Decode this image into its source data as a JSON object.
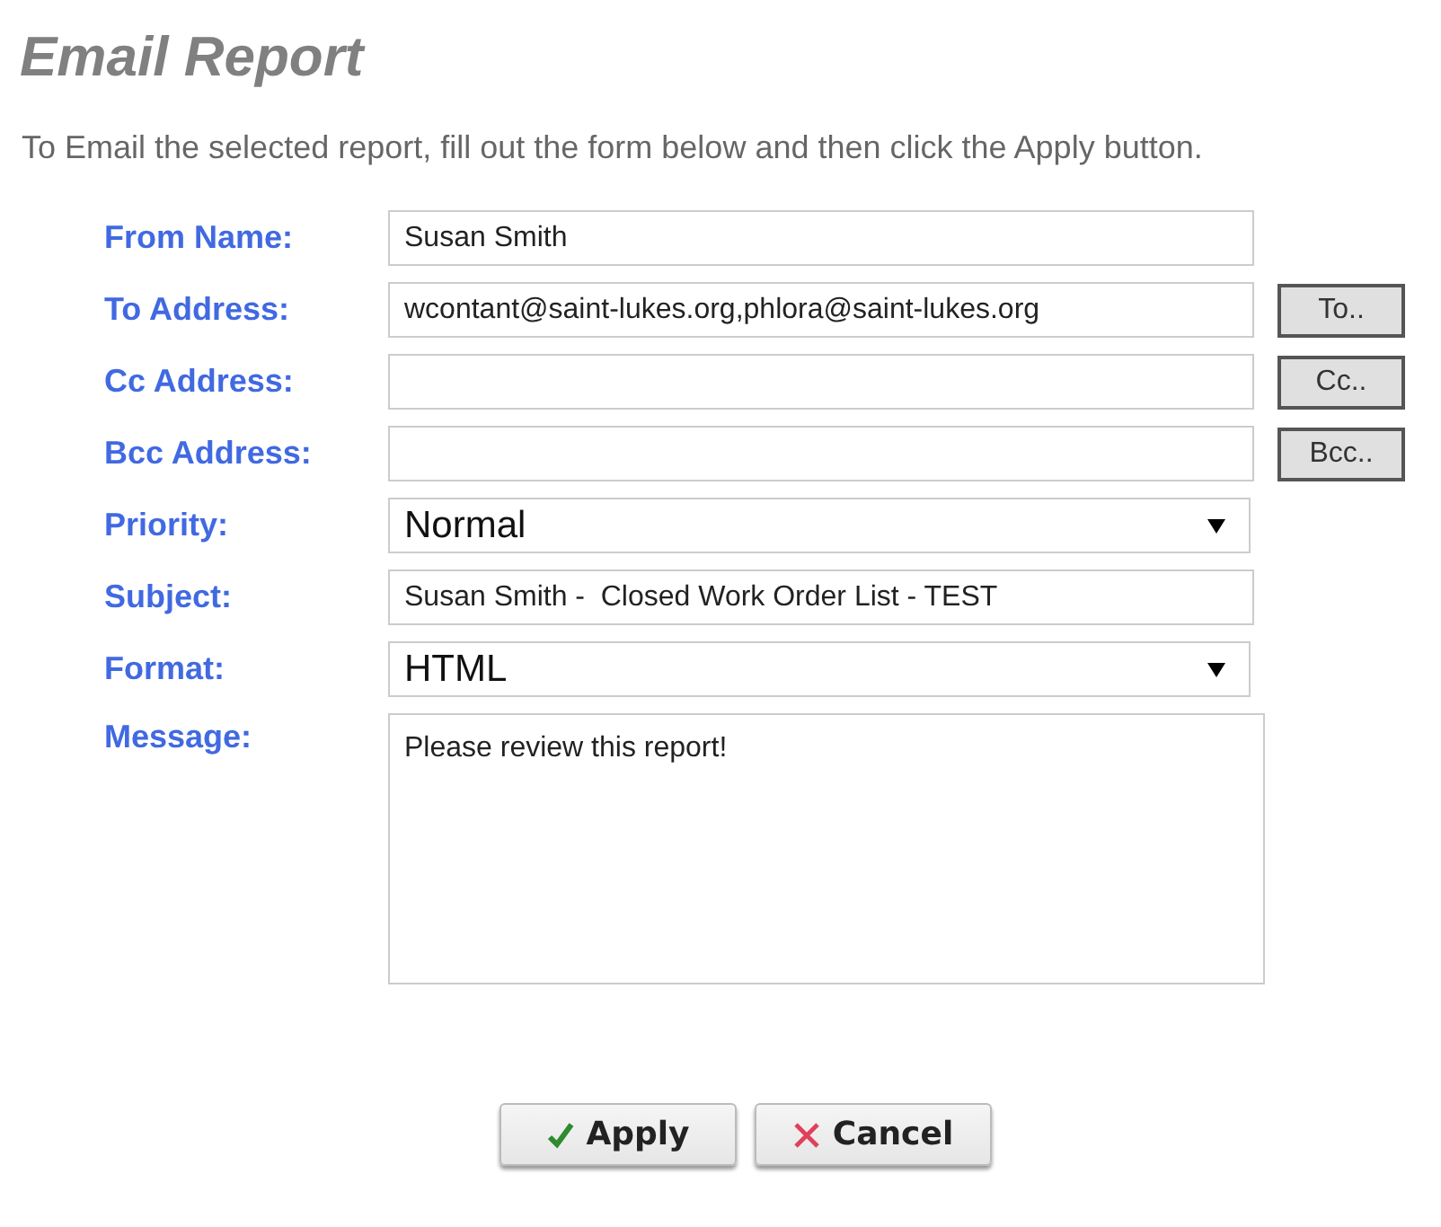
{
  "title": "Email Report",
  "instructions": "To Email the selected report, fill out the form below and then click the Apply button.",
  "fields": [
    {
      "label": "From Name:",
      "kind": "text",
      "value": "Susan Smith"
    },
    {
      "label": "To Address:",
      "kind": "text",
      "value": "wcontant@saint-lukes.org,phlora@saint-lukes.org",
      "button": "To.."
    },
    {
      "label": "Cc Address:",
      "kind": "text",
      "button": "Cc.."
    },
    {
      "label": "Bcc Address:",
      "kind": "text",
      "button": "Bcc.."
    },
    {
      "label": "Priority:",
      "kind": "select",
      "value": "Normal"
    },
    {
      "label": "Subject:",
      "kind": "text",
      "value": "Susan Smith -  Closed Work Order List - TEST"
    },
    {
      "label": "Format:",
      "kind": "select",
      "value": "HTML"
    },
    {
      "label": "Message:",
      "kind": "textarea",
      "value": "Please review this report!"
    }
  ],
  "actions": [
    {
      "label": "Apply",
      "kind": "apply"
    },
    {
      "label": "Cancel",
      "kind": "cancel"
    }
  ]
}
